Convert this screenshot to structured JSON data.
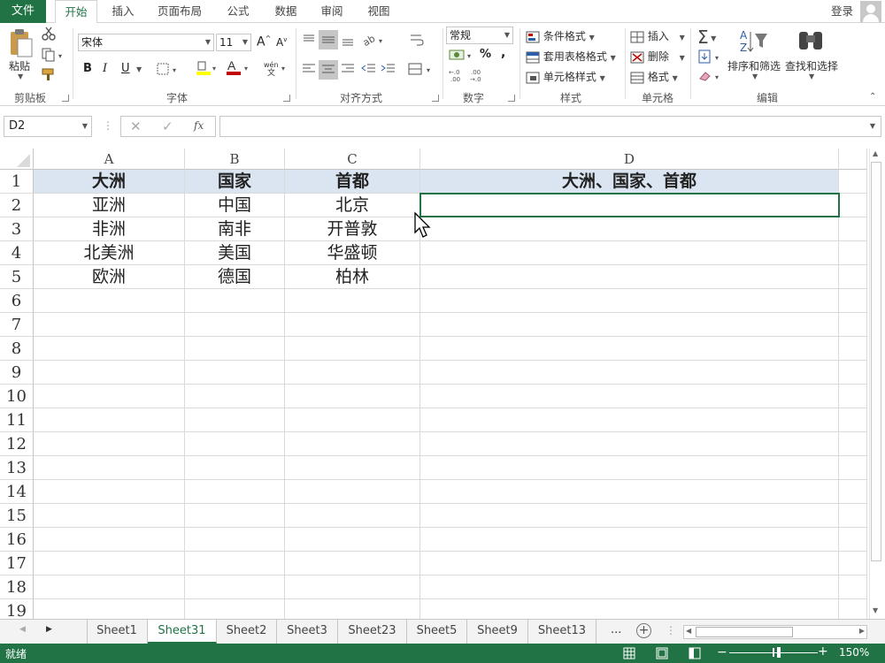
{
  "app": {
    "tabs": [
      "文件",
      "开始",
      "插入",
      "页面布局",
      "公式",
      "数据",
      "审阅",
      "视图"
    ],
    "active_tab": "开始",
    "login": "登录"
  },
  "ribbon": {
    "clipboard": {
      "paste": "粘贴",
      "label": "剪贴板"
    },
    "font": {
      "name": "宋体",
      "size": "11",
      "bold": "B",
      "italic": "I",
      "underline": "U",
      "label": "字体",
      "grow": "A",
      "shrink": "A"
    },
    "alignment": {
      "label": "对齐方式"
    },
    "number": {
      "format": "常规",
      "percent": "%",
      "comma": ",",
      "label": "数字"
    },
    "styles": {
      "conditional": "条件格式",
      "table": "套用表格格式",
      "cell": "单元格样式",
      "label": "样式"
    },
    "cells": {
      "insert": "插入",
      "delete": "删除",
      "format": "格式",
      "label": "单元格"
    },
    "editing": {
      "sort": "排序和筛选",
      "find": "查找和选择",
      "label": "编辑"
    }
  },
  "formula_bar": {
    "name_box": "D2",
    "fx": "fx",
    "value": ""
  },
  "grid": {
    "columns": [
      "A",
      "B",
      "C",
      "D"
    ],
    "rows": [
      "1",
      "2",
      "3",
      "4",
      "5",
      "6",
      "7",
      "8",
      "9",
      "10",
      "11",
      "12",
      "13",
      "14",
      "15",
      "16",
      "17",
      "18",
      "19"
    ],
    "header_row": [
      "大洲",
      "国家",
      "首都",
      "大洲、国家、首都"
    ],
    "data_rows": [
      [
        "亚洲",
        "中国",
        "北京",
        ""
      ],
      [
        "非洲",
        "南非",
        "开普敦",
        ""
      ],
      [
        "北美洲",
        "美国",
        "华盛顿",
        ""
      ],
      [
        "欧洲",
        "德国",
        "柏林",
        ""
      ]
    ]
  },
  "sheets": {
    "tabs": [
      "Sheet1",
      "Sheet31",
      "Sheet2",
      "Sheet3",
      "Sheet23",
      "Sheet5",
      "Sheet9",
      "Sheet13"
    ],
    "active": "Sheet31",
    "more": "...",
    "add": "+"
  },
  "status": {
    "ready": "就绪",
    "zoom": "150%"
  },
  "colors": {
    "accent": "#217346",
    "header_fill": "#dbe5f1"
  }
}
